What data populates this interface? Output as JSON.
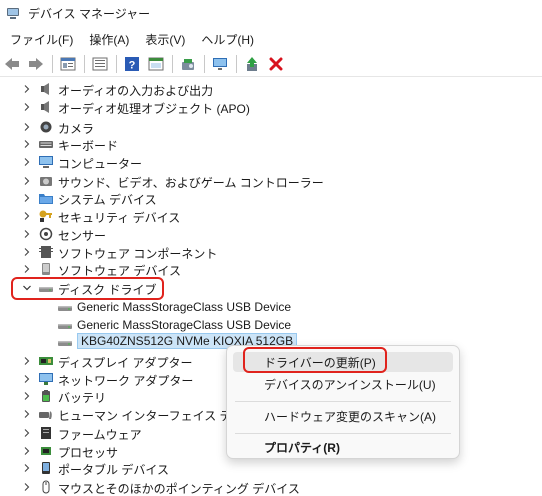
{
  "window": {
    "title": "デバイス マネージャー"
  },
  "menu": [
    "ファイル(F)",
    "操作(A)",
    "表示(V)",
    "ヘルプ(H)"
  ],
  "toolbar": [
    "back-icon",
    "forward-icon",
    "properties-icon",
    "details-icon",
    "help-icon",
    "view-icon",
    "scan-hardware-icon",
    "monitor-icon",
    "update-driver-icon",
    "uninstall-icon"
  ],
  "tree": {
    "items": [
      {
        "label": "オーディオの入力および出力",
        "icon": "audio-io-icon"
      },
      {
        "label": "オーディオ処理オブジェクト (APO)",
        "icon": "audio-apo-icon"
      },
      {
        "label": "カメラ",
        "icon": "camera-icon"
      },
      {
        "label": "キーボード",
        "icon": "keyboard-icon"
      },
      {
        "label": "コンピューター",
        "icon": "computer-icon"
      },
      {
        "label": "サウンド、ビデオ、およびゲーム コントローラー",
        "icon": "sound-icon"
      },
      {
        "label": "システム デバイス",
        "icon": "system-folder-icon"
      },
      {
        "label": "セキュリティ デバイス",
        "icon": "security-key-icon"
      },
      {
        "label": "センサー",
        "icon": "sensor-icon"
      },
      {
        "label": "ソフトウェア コンポーネント",
        "icon": "software-component-icon"
      },
      {
        "label": "ソフトウェア デバイス",
        "icon": "software-device-icon"
      },
      {
        "label": "ディスク ドライブ",
        "icon": "disk-drive-icon"
      },
      {
        "label": "Generic MassStorageClass USB Device",
        "icon": "disk-drive-icon"
      },
      {
        "label": "Generic MassStorageClass USB Device",
        "icon": "disk-drive-icon"
      },
      {
        "label": "KBG40ZNS512G NVMe KIOXIA 512GB",
        "icon": "disk-drive-icon"
      },
      {
        "label": "ディスプレイ アダプター",
        "icon": "display-adapter-icon"
      },
      {
        "label": "ネットワーク アダプター",
        "icon": "network-adapter-icon"
      },
      {
        "label": "バッテリ",
        "icon": "battery-icon"
      },
      {
        "label": "ヒューマン インターフェイス デバイス",
        "icon": "hid-icon"
      },
      {
        "label": "ファームウェア",
        "icon": "firmware-icon"
      },
      {
        "label": "プロセッサ",
        "icon": "processor-icon"
      },
      {
        "label": "ポータブル デバイス",
        "icon": "portable-device-icon"
      },
      {
        "label": "マウスとそのほかのポインティング デバイス",
        "icon": "mouse-icon"
      }
    ]
  },
  "context_menu": {
    "items": [
      "ドライバーの更新(P)",
      "デバイスのアンインストール(U)",
      "ハードウェア変更のスキャン(A)",
      "プロパティ(R)"
    ]
  },
  "colors": {
    "highlight": "#e0231d",
    "selection": "#cce4f7"
  }
}
